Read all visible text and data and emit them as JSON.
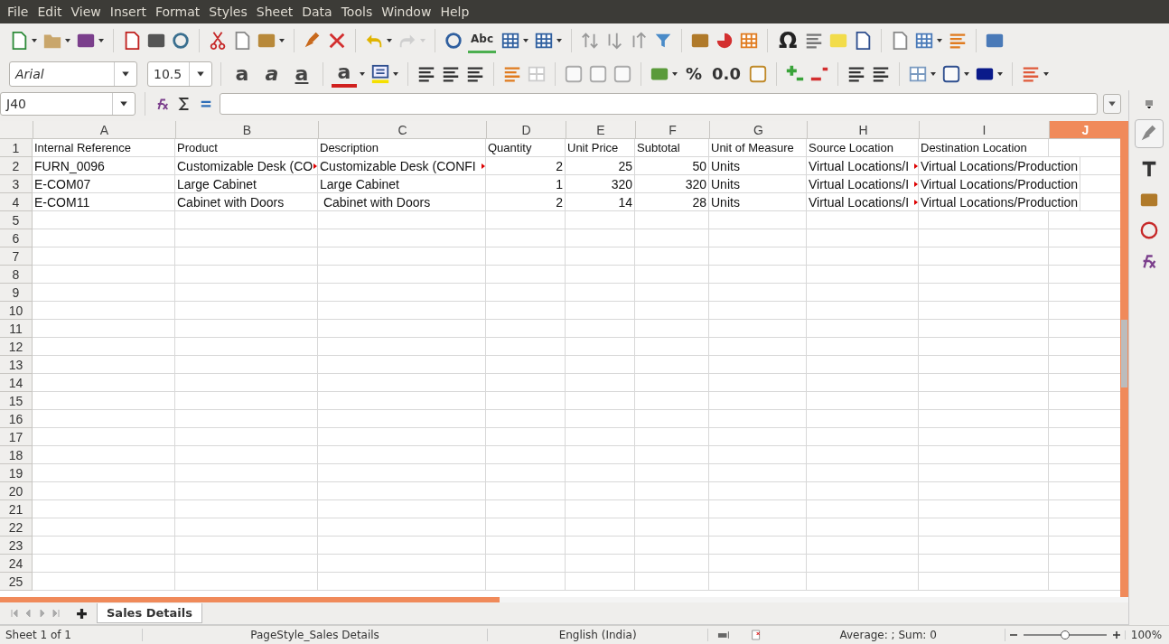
{
  "menu": [
    {
      "label": "File"
    },
    {
      "label": "Edit"
    },
    {
      "label": "View"
    },
    {
      "label": "Insert"
    },
    {
      "label": "Format"
    },
    {
      "label": "Styles"
    },
    {
      "label": "Sheet"
    },
    {
      "label": "Data"
    },
    {
      "label": "Tools"
    },
    {
      "label": "Window"
    },
    {
      "label": "Help"
    }
  ],
  "toolbar_labels": {
    "spelling": "Abc",
    "special_character": "Ω",
    "bold": "a",
    "italic": "a",
    "underline": "a",
    "font_color": "a",
    "percent": "%",
    "number_format": "0.0"
  },
  "font": {
    "name": "Arial",
    "size": "10.5"
  },
  "name_box": "J40",
  "columns": [
    {
      "letter": "A",
      "selected": false
    },
    {
      "letter": "B",
      "selected": false
    },
    {
      "letter": "C",
      "selected": false
    },
    {
      "letter": "D",
      "selected": false
    },
    {
      "letter": "E",
      "selected": false
    },
    {
      "letter": "F",
      "selected": false
    },
    {
      "letter": "G",
      "selected": false
    },
    {
      "letter": "H",
      "selected": false
    },
    {
      "letter": "I",
      "selected": false
    },
    {
      "letter": "J",
      "selected": true
    }
  ],
  "rows": [
    {
      "number": "1",
      "cells": [
        {
          "text": "Internal Reference",
          "kind": "text"
        },
        {
          "text": "Product",
          "kind": "text"
        },
        {
          "text": "Description",
          "kind": "text"
        },
        {
          "text": "Quantity",
          "kind": "text"
        },
        {
          "text": "Unit Price",
          "kind": "text"
        },
        {
          "text": "Subtotal",
          "kind": "text"
        },
        {
          "text": "Unit of Measure",
          "kind": "text"
        },
        {
          "text": "Source Location",
          "kind": "text"
        },
        {
          "text": "Destination Location",
          "kind": "text"
        }
      ]
    },
    {
      "number": "2",
      "cells": [
        {
          "text": "FURN_0096",
          "kind": "text"
        },
        {
          "text": "Customizable Desk (CO",
          "kind": "text",
          "clipped": true
        },
        {
          "text": "Customizable Desk (CONFI",
          "kind": "text",
          "clipped": true
        },
        {
          "text": "2",
          "kind": "number"
        },
        {
          "text": "25",
          "kind": "number"
        },
        {
          "text": "50",
          "kind": "number"
        },
        {
          "text": "Units",
          "kind": "text"
        },
        {
          "text": "Virtual Locations/I",
          "kind": "text",
          "clipped": true
        },
        {
          "text": "Virtual Locations/Production",
          "kind": "text"
        }
      ]
    },
    {
      "number": "3",
      "cells": [
        {
          "text": "E-COM07",
          "kind": "text"
        },
        {
          "text": "Large Cabinet",
          "kind": "text"
        },
        {
          "text": "Large Cabinet",
          "kind": "text"
        },
        {
          "text": "1",
          "kind": "number"
        },
        {
          "text": "320",
          "kind": "number"
        },
        {
          "text": "320",
          "kind": "number"
        },
        {
          "text": "Units",
          "kind": "text"
        },
        {
          "text": "Virtual Locations/I",
          "kind": "text",
          "clipped": true
        },
        {
          "text": "Virtual Locations/Production",
          "kind": "text"
        }
      ]
    },
    {
      "number": "4",
      "cells": [
        {
          "text": "E-COM11",
          "kind": "text"
        },
        {
          "text": "Cabinet with Doors",
          "kind": "text"
        },
        {
          "text": " Cabinet with Doors",
          "kind": "text"
        },
        {
          "text": "2",
          "kind": "number"
        },
        {
          "text": "14",
          "kind": "number"
        },
        {
          "text": "28",
          "kind": "number"
        },
        {
          "text": "Units",
          "kind": "text"
        },
        {
          "text": "Virtual Locations/I",
          "kind": "text",
          "clipped": true
        },
        {
          "text": "Virtual Locations/Production",
          "kind": "text"
        }
      ]
    },
    {
      "number": "5",
      "cells": []
    },
    {
      "number": "6",
      "cells": []
    },
    {
      "number": "7",
      "cells": []
    },
    {
      "number": "8",
      "cells": []
    },
    {
      "number": "9",
      "cells": []
    },
    {
      "number": "10",
      "cells": []
    },
    {
      "number": "11",
      "cells": []
    },
    {
      "number": "12",
      "cells": []
    },
    {
      "number": "13",
      "cells": []
    },
    {
      "number": "14",
      "cells": []
    },
    {
      "number": "15",
      "cells": []
    },
    {
      "number": "16",
      "cells": []
    },
    {
      "number": "17",
      "cells": []
    },
    {
      "number": "18",
      "cells": []
    },
    {
      "number": "19",
      "cells": []
    },
    {
      "number": "20",
      "cells": []
    },
    {
      "number": "21",
      "cells": []
    },
    {
      "number": "22",
      "cells": []
    },
    {
      "number": "23",
      "cells": []
    },
    {
      "number": "24",
      "cells": []
    },
    {
      "number": "25",
      "cells": []
    }
  ],
  "sheet_tabs": [
    {
      "label": "Sales Details",
      "selected": true
    }
  ],
  "status_bar": {
    "sheet": "Sheet 1 of 1",
    "page_style": "PageStyle_Sales Details",
    "language": "English (India)",
    "summary": "Average: ; Sum: 0",
    "zoom_slider": {
      "level": 0.5
    },
    "zoom": "100%"
  }
}
